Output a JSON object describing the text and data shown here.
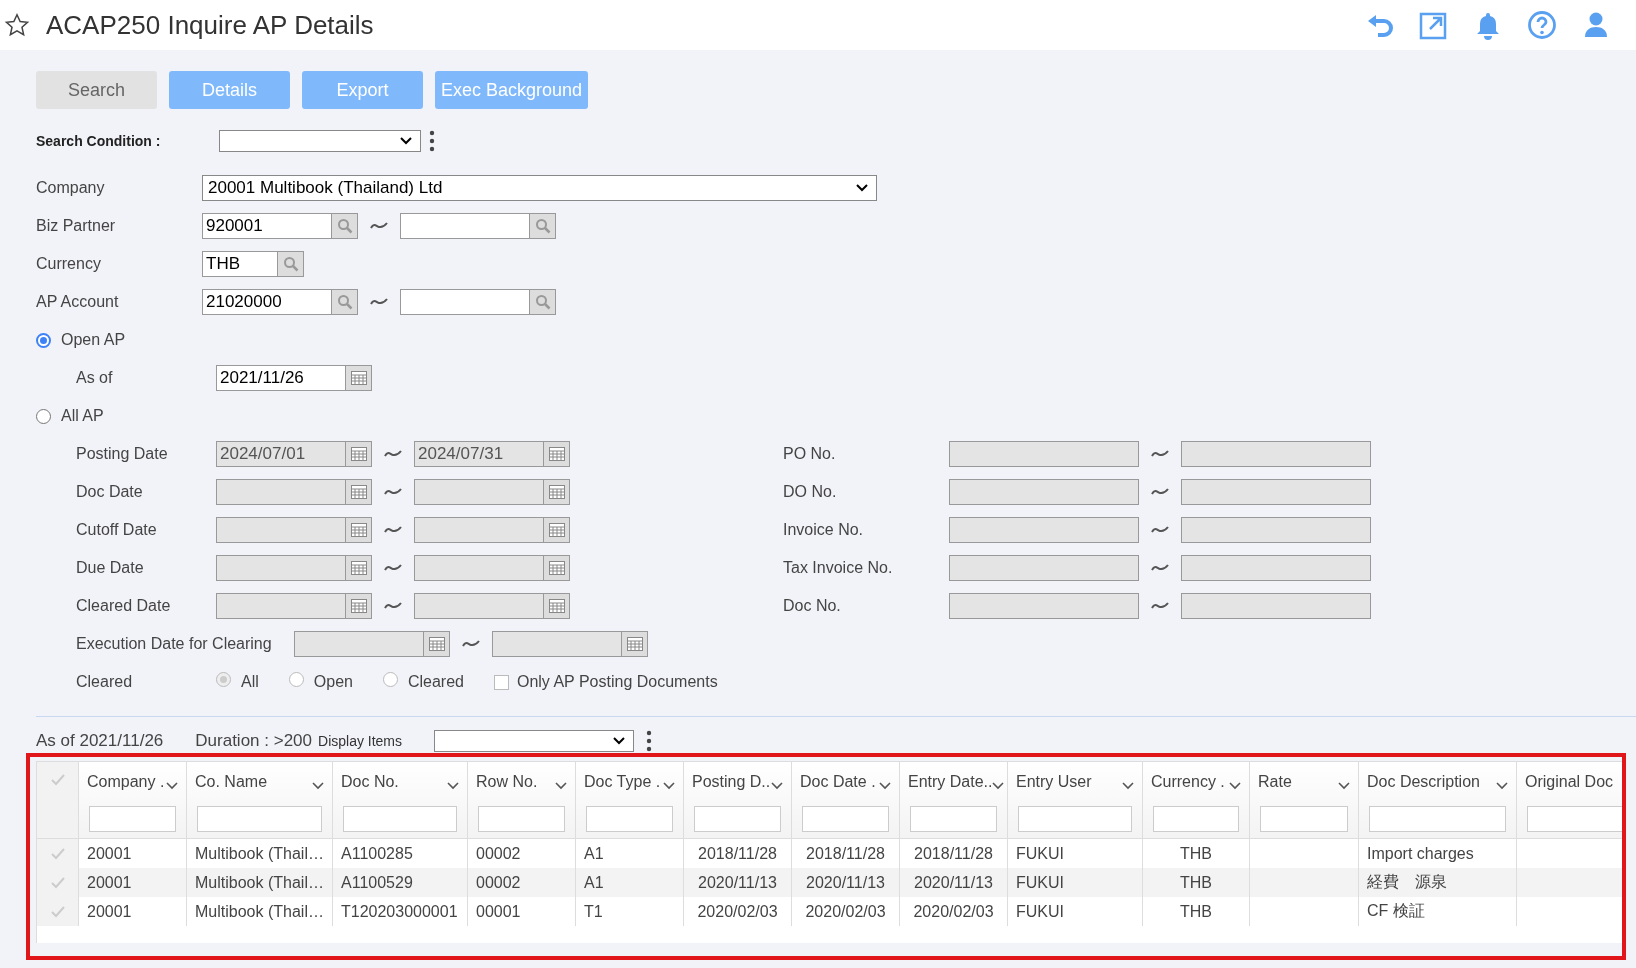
{
  "header": {
    "title": "ACAP250 Inquire AP Details"
  },
  "toolbar": [
    {
      "label": "Search",
      "kind": "secondary"
    },
    {
      "label": "Details",
      "kind": "primary"
    },
    {
      "label": "Export",
      "kind": "primary"
    },
    {
      "label": "Exec Background",
      "kind": "primary"
    }
  ],
  "search_condition": {
    "label": "Search Condition :"
  },
  "company": {
    "label": "Company",
    "value": "20001 Multibook (Thailand) Ltd"
  },
  "lookups": [
    {
      "label": "Biz Partner",
      "range": true,
      "from": "920001"
    },
    {
      "label": "Currency",
      "range": false,
      "from": "THB"
    },
    {
      "label": "AP Account",
      "range": true,
      "from": "21020000"
    }
  ],
  "open_ap": {
    "label": "Open AP",
    "selected": true,
    "as_of_label": "As of",
    "as_of": "2021/11/26"
  },
  "all_ap": {
    "label": "All AP",
    "selected": false
  },
  "date_ranges": [
    {
      "label": "Posting Date",
      "disabled": true,
      "from": "2024/07/01",
      "to": "2024/07/31"
    },
    {
      "label": "Doc Date",
      "disabled": true
    },
    {
      "label": "Cutoff Date",
      "disabled": true
    },
    {
      "label": "Due Date",
      "disabled": true
    },
    {
      "label": "Cleared Date",
      "disabled": true
    }
  ],
  "number_ranges": [
    {
      "label": "PO No.",
      "disabled": true
    },
    {
      "label": "DO No.",
      "disabled": true
    },
    {
      "label": "Invoice No.",
      "disabled": true
    },
    {
      "label": "Tax Invoice No.",
      "disabled": true
    },
    {
      "label": "Doc No.",
      "disabled": true
    }
  ],
  "execution_date": {
    "label": "Execution Date for Clearing",
    "disabled": true
  },
  "cleared": {
    "label": "Cleared",
    "options": [
      {
        "label": "All",
        "selected": true
      },
      {
        "label": "Open",
        "selected": false
      },
      {
        "label": "Cleared",
        "selected": false
      }
    ],
    "only_ap": {
      "label": "Only AP Posting Documents",
      "checked": false
    }
  },
  "result_bar": {
    "as_of": "As of 2021/11/26",
    "duration": "Duration : >200",
    "display_items_label": "Display Items"
  },
  "table": {
    "columns": [
      {
        "label": "Company ."
      },
      {
        "label": "Co. Name"
      },
      {
        "label": "Doc No."
      },
      {
        "label": "Row No."
      },
      {
        "label": "Doc Type ."
      },
      {
        "label": "Posting D.."
      },
      {
        "label": "Doc Date ."
      },
      {
        "label": "Entry Date.."
      },
      {
        "label": "Entry User"
      },
      {
        "label": "Currency ."
      },
      {
        "label": "Rate"
      },
      {
        "label": "Doc Description"
      },
      {
        "label": "Original Doc"
      }
    ],
    "rows": [
      [
        "20001",
        "Multibook (Thail…",
        "A1100285",
        "00002",
        "A1",
        "2018/11/28",
        "2018/11/28",
        "2018/11/28",
        "FUKUI",
        "THB",
        null,
        "Import charges",
        null
      ],
      [
        "20001",
        "Multibook (Thail…",
        "A1100529",
        "00002",
        "A1",
        "2020/11/13",
        "2020/11/13",
        "2020/11/13",
        "FUKUI",
        "THB",
        null,
        "経費　源泉",
        null
      ],
      [
        "20001",
        "Multibook (Thail…",
        "T120203000001",
        "00001",
        "T1",
        "2020/02/03",
        "2020/02/03",
        "2020/02/03",
        "FUKUI",
        "THB",
        null,
        "CF 検証",
        null
      ]
    ]
  }
}
